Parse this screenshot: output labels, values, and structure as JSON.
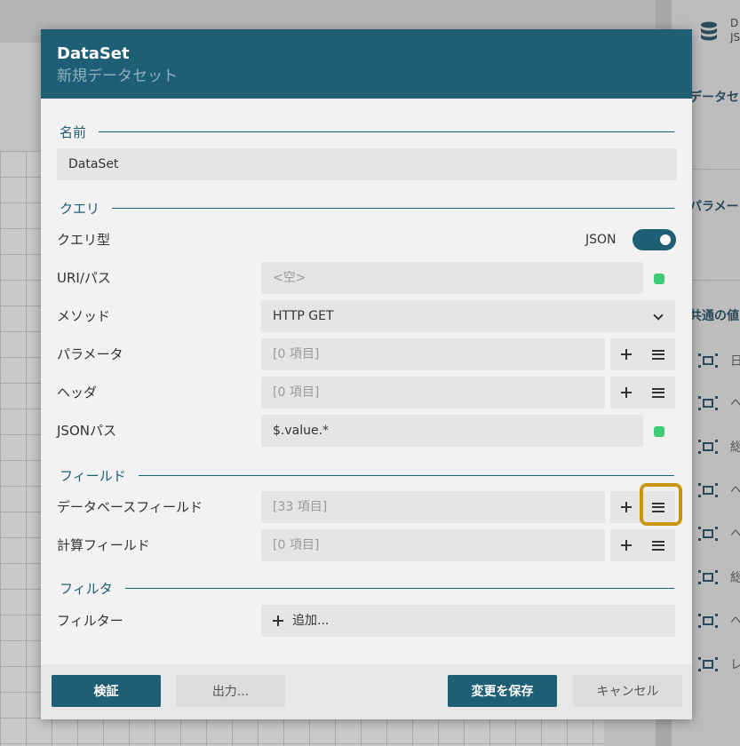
{
  "background": {
    "right_panel": {
      "db_text_line1": "D",
      "db_text_line2": "JS",
      "section_dataset": "データセ",
      "section_params": "パラメー",
      "section_common": "共通の値",
      "rows": [
        "日",
        "ヘ",
        "総",
        "ヘ",
        "ヘ",
        "総",
        "ヘ",
        "レ"
      ]
    }
  },
  "dialog": {
    "title": "DataSet",
    "subtitle": "新規データセット",
    "name_section": {
      "header": "名前",
      "value": "DataSet"
    },
    "query_section": {
      "header": "クエリ",
      "query_type_label": "クエリ型",
      "query_type_value": "JSON",
      "query_type_enabled": true,
      "uri_label": "URI/パス",
      "uri_placeholder": "<空>",
      "method_label": "メソッド",
      "method_value": "HTTP GET",
      "params_label": "パラメータ",
      "params_value": "[0 項目]",
      "headers_label": "ヘッダ",
      "headers_value": "[0 項目]",
      "jsonpath_label": "JSONパス",
      "jsonpath_value": "$.value.*"
    },
    "fields_section": {
      "header": "フィールド",
      "db_fields_label": "データベースフィールド",
      "db_fields_value": "[33 項目]",
      "calc_fields_label": "計算フィールド",
      "calc_fields_value": "[0 項目]"
    },
    "filter_section": {
      "header": "フィルタ",
      "filter_label": "フィルター",
      "add_label": "追加..."
    },
    "footer": {
      "validate_label": "検証",
      "export_label": "出力...",
      "save_label": "変更を保存",
      "cancel_label": "キャンセル"
    }
  },
  "colors": {
    "accent": "#1e5f75",
    "status_ok": "#3dcc74",
    "highlight": "#c8950c"
  },
  "icons": [
    "database-icon",
    "plus-icon",
    "menu-icon",
    "chevron-down-icon",
    "toggle-switch"
  ]
}
